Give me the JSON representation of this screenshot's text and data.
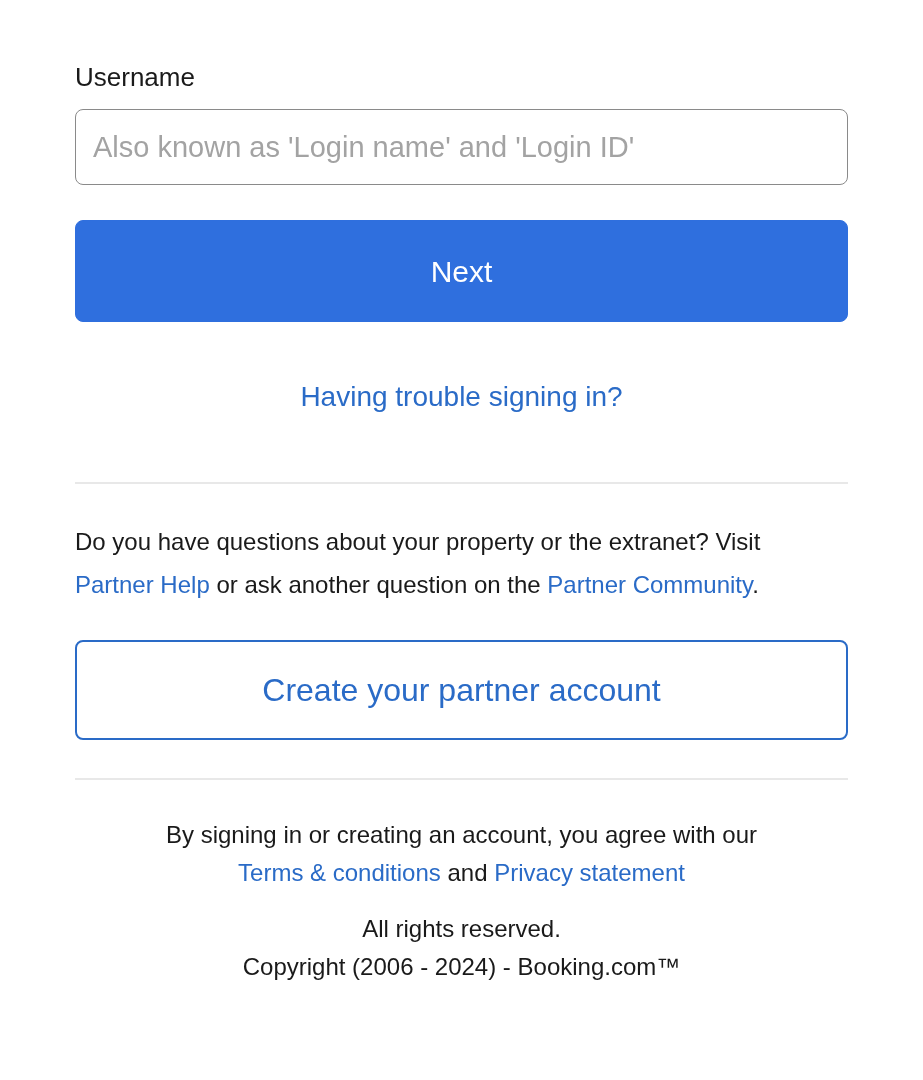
{
  "username": {
    "label": "Username",
    "placeholder": "Also known as 'Login name' and 'Login ID'"
  },
  "next_button": "Next",
  "trouble_link": "Having trouble signing in?",
  "help_text": [
    {
      "kind": "text",
      "text": "Do you have questions about your property or the extranet? Visit "
    },
    {
      "kind": "link",
      "text": "Partner Help"
    },
    {
      "kind": "text",
      "text": " or ask another question on the "
    },
    {
      "kind": "link",
      "text": "Partner Community"
    },
    {
      "kind": "text",
      "text": "."
    }
  ],
  "create_button": "Create your partner account",
  "terms_text": [
    {
      "kind": "text",
      "text": "By signing in or creating an account, you agree with our "
    },
    {
      "kind": "link",
      "text": "Terms & conditions"
    },
    {
      "kind": "text",
      "text": " and "
    },
    {
      "kind": "link",
      "text": "Privacy statement"
    }
  ],
  "footer_lines": [
    "All rights reserved.",
    "Copyright (2006 - 2024) - Booking.com™"
  ]
}
